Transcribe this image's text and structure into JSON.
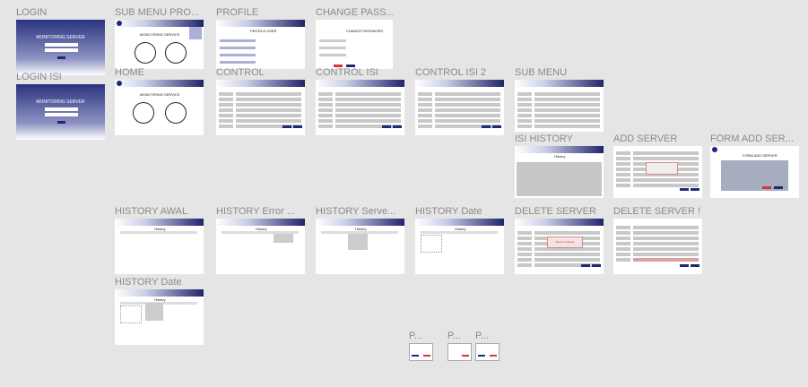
{
  "frames": {
    "login": {
      "label": "LOGIN",
      "title": "MONITORING SERVER"
    },
    "login_isi": {
      "label": "LOGIN ISI",
      "title": "MONITORING SERVER"
    },
    "sub_menu_pro": {
      "label": "SUB MENU PRO...",
      "title": "MONITORING SERVICE"
    },
    "home": {
      "label": "HOME",
      "title": "MONITORING SERVICE"
    },
    "profile": {
      "label": "PROFILE",
      "title": "PROFILE USER"
    },
    "change_pass": {
      "label": "CHANGE PASS...",
      "title": "CHANGE PASSWORD"
    },
    "control": {
      "label": "CONTROL"
    },
    "control_isi": {
      "label": "CONTROL ISI"
    },
    "control_isi_2": {
      "label": "CONTROL ISI 2"
    },
    "sub_menu": {
      "label": "SUB MENU"
    },
    "isi_history": {
      "label": "ISI HISTORY",
      "title": "History"
    },
    "add_server": {
      "label": "ADD SERVER"
    },
    "form_add_ser": {
      "label": "FORM ADD SER...",
      "title": "FORM ADD SERVER"
    },
    "history_awal": {
      "label": "HISTORY AWAL",
      "title": "History"
    },
    "history_error": {
      "label": "HISTORY Error ...",
      "title": "History"
    },
    "history_serve": {
      "label": "HISTORY Serve...",
      "title": "History"
    },
    "history_date": {
      "label": "HISTORY Date",
      "title": "History"
    },
    "delete_server": {
      "label": "DELETE SERVER",
      "popup": "Server di delete"
    },
    "delete_server2": {
      "label": "DELETE SERVER !"
    },
    "history_date2": {
      "label": "HISTORY Date",
      "title": "History"
    },
    "popup1": {
      "label": "P..."
    },
    "popup2": {
      "label": "P..."
    },
    "popup3": {
      "label": "P..."
    }
  },
  "colors": {
    "canvas": "#e5e5e5",
    "primary": "#1e2a78",
    "danger": "#d33333"
  }
}
